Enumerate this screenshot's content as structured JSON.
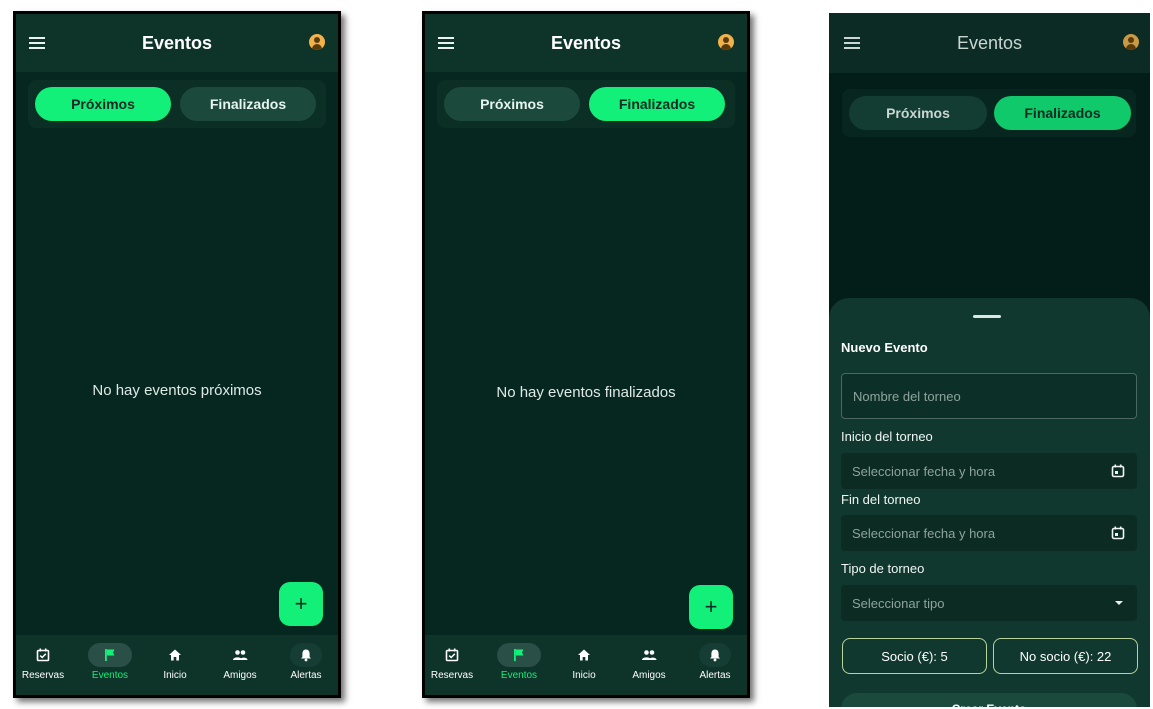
{
  "app": {
    "title": "Eventos"
  },
  "tabs": {
    "upcoming": "Próximos",
    "finished": "Finalizados"
  },
  "screens": [
    {
      "active_tab": "upcoming",
      "empty_message": "No hay eventos próximos"
    },
    {
      "active_tab": "finished",
      "empty_message": "No hay eventos finalizados"
    },
    {
      "active_tab": "finished"
    }
  ],
  "bottom_nav": {
    "items": [
      {
        "label": "Reservas",
        "icon": "calendar-check-icon"
      },
      {
        "label": "Eventos",
        "icon": "flag-icon",
        "selected": true
      },
      {
        "label": "Inicio",
        "icon": "home-icon"
      },
      {
        "label": "Amigos",
        "icon": "people-icon"
      },
      {
        "label": "Alertas",
        "icon": "bell-icon"
      }
    ]
  },
  "fab": {
    "label": "+",
    "icon": "plus-icon"
  },
  "new_event_form": {
    "title": "Nuevo Evento",
    "name_placeholder": "Nombre del torneo",
    "start_label": "Inicio del torneo",
    "start_placeholder": "Seleccionar fecha y hora",
    "end_label": "Fin del torneo",
    "end_placeholder": "Seleccionar fecha y hora",
    "type_label": "Tipo de torneo",
    "type_placeholder": "Seleccionar tipo",
    "member_price": "Socio (€): 5",
    "non_member_price": "No socio (€): 22",
    "submit_label": "Crear Evento"
  },
  "colors": {
    "accent": "#13f07a",
    "background": "#052720",
    "appbar": "#0e3329",
    "sheet": "#10382e"
  }
}
